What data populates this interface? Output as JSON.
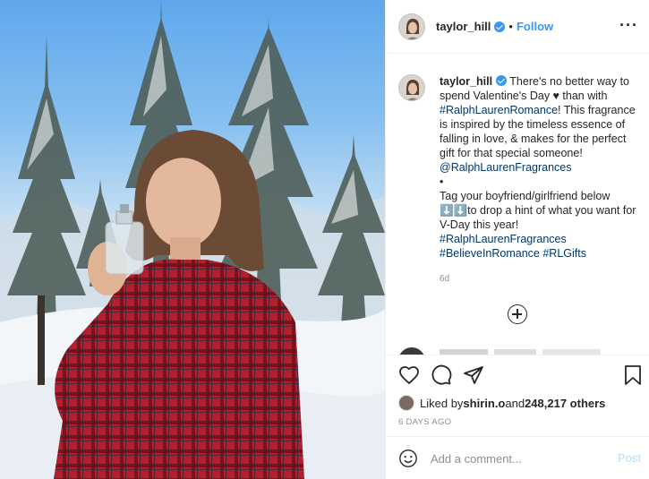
{
  "header": {
    "username": "taylor_hill",
    "dot": "•",
    "follow_label": "Follow",
    "more_label": "···"
  },
  "caption": {
    "username": "taylor_hill",
    "text_1": " There's no better way to spend Valentine's Day ♥ than with ",
    "tag_1": "#RalphLaurenRomance",
    "text_2": "! This fragrance is inspired by the timeless essence of falling in love, & makes for the perfect gift for that special someone! ",
    "mention_1": "@RalphLaurenFragrances",
    "text_3": "\n•\nTag your boyfriend/girlfriend below ⬇️⬇️to drop a hint of what you want for V-Day this year!\n",
    "tag_2": "#RalphLaurenFragrances",
    "tag_3": "#BelieveInRomance",
    "tag_4": "#RLGifts",
    "age": "6d"
  },
  "likes": {
    "prefix": "Liked by ",
    "user": "shirin.o",
    "middle": " and ",
    "count": "248,217 others"
  },
  "date": "6 DAYS AGO",
  "comment": {
    "placeholder": "Add a comment...",
    "post_label": "Post"
  },
  "colors": {
    "accent": "#3897f0",
    "link": "#00376b",
    "muted": "#8e8e8e",
    "post_disabled": "#b2dffc"
  },
  "icons": {
    "heart": "heart-icon",
    "comment": "comment-icon",
    "share": "share-icon",
    "save": "bookmark-icon",
    "emoji": "emoji-icon",
    "add": "plus-circle-icon",
    "verified": "verified-badge-icon"
  }
}
